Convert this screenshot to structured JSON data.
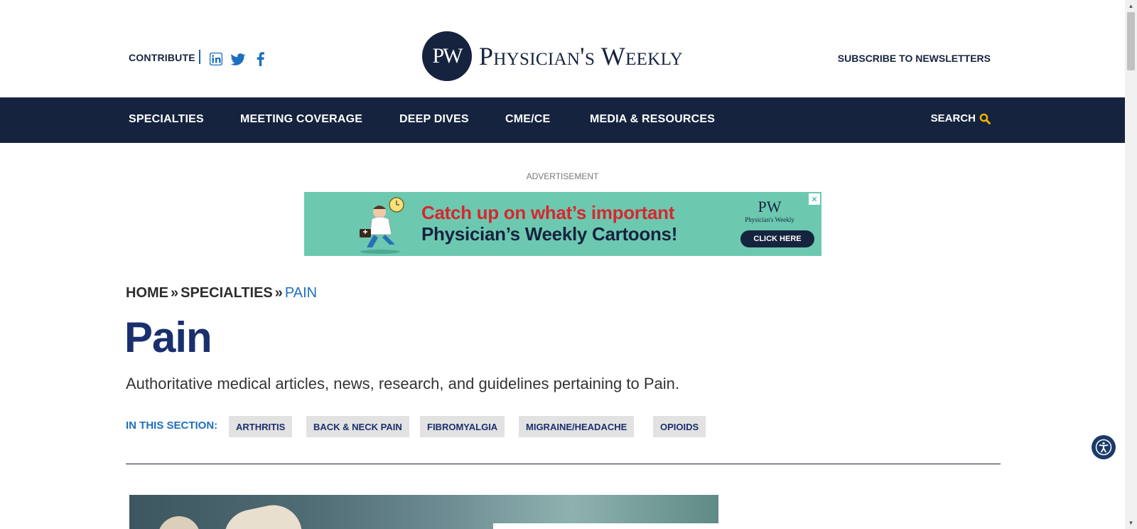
{
  "header": {
    "contribute_label": "CONTRIBUTE",
    "social": [
      "linkedin-icon",
      "twitter-icon",
      "facebook-icon"
    ],
    "logo_mark": "PW",
    "logo_text": "Physician's Weekly",
    "subscribe_label": "SUBSCRIBE TO NEWSLETTERS"
  },
  "nav": {
    "items": [
      {
        "label": "SPECIALTIES"
      },
      {
        "label": "MEETING COVERAGE"
      },
      {
        "label": "DEEP DIVES"
      },
      {
        "label": "CME/CE"
      },
      {
        "label": "MEDIA & RESOURCES"
      }
    ],
    "search_label": "SEARCH",
    "search_icon": "search-icon"
  },
  "ad": {
    "label": "ADVERTISEMENT",
    "line1": "Catch up on what’s important",
    "line2": "Physician’s Weekly Cartoons!",
    "logo_mark": "PW",
    "logo_brand": "Physician's Weekly",
    "cta": "CLICK HERE",
    "close_glyph": "✕"
  },
  "breadcrumb": {
    "items": [
      "HOME",
      "SPECIALTIES"
    ],
    "separator": "»",
    "current": "PAIN"
  },
  "page": {
    "title": "Pain",
    "description": "Authoritative medical articles, news, research, and guidelines pertaining to Pain."
  },
  "section": {
    "label": "IN THIS SECTION:",
    "tags": [
      "ARTHRITIS",
      "BACK & NECK PAIN",
      "FIBROMYALGIA",
      "MIGRAINE/HEADACHE",
      "OPIOIDS"
    ]
  },
  "colors": {
    "navy": "#16233f",
    "title_blue": "#1b2f6e",
    "link_blue": "#1e6fbf",
    "accent_yellow": "#f5b400",
    "ad_teal": "#6cc9b0",
    "ad_red": "#d8262e"
  }
}
